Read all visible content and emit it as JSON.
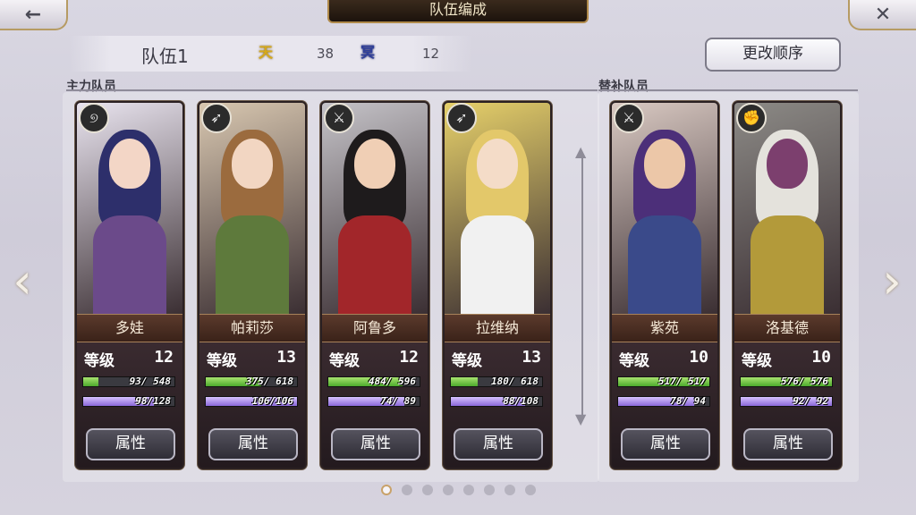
{
  "header": {
    "title": "队伍编成",
    "back_icon": "back-arrow-icon",
    "close_icon": "close-icon"
  },
  "team": {
    "name": "队伍1",
    "sun_stat": "38",
    "moon_stat": "12",
    "sun_glyph": "天",
    "moon_glyph": "冥"
  },
  "reorder_label": "更改顺序",
  "sections": {
    "main": "主力队员",
    "sub": "替补队员"
  },
  "members": [
    {
      "name": "多娃",
      "level_label": "等级",
      "level": "12",
      "hp": "93/ 548",
      "hp_frac": 0.17,
      "mp": "98/128",
      "mp_frac": 0.77,
      "attr_label": "属性",
      "weapon_icon": "staff-icon",
      "weapon_glyph": "୭",
      "hair": "#2d2f6b",
      "skin": "#f3d6c6",
      "body": "#6b4a8a",
      "bg": "#e9e4ef"
    },
    {
      "name": "帕莉莎",
      "level_label": "等级",
      "level": "13",
      "hp": "375/ 618",
      "hp_frac": 0.61,
      "mp": "106/106",
      "mp_frac": 1.0,
      "attr_label": "属性",
      "weapon_icon": "bow-icon",
      "weapon_glyph": "➶",
      "hair": "#9b6b3e",
      "skin": "#f2d6c2",
      "body": "#5e7a3c",
      "bg": "#d8c7b0"
    },
    {
      "name": "阿鲁多",
      "level_label": "等级",
      "level": "12",
      "hp": "484/ 596",
      "hp_frac": 0.81,
      "mp": "74/ 89",
      "mp_frac": 0.83,
      "attr_label": "属性",
      "weapon_icon": "sword-icon",
      "weapon_glyph": "⚔",
      "hair": "#1e1b1c",
      "skin": "#f0cfb5",
      "body": "#a2262a",
      "bg": "#c5c3c8"
    },
    {
      "name": "拉维纳",
      "level_label": "等级",
      "level": "13",
      "hp": "180/ 618",
      "hp_frac": 0.29,
      "mp": "88/108",
      "mp_frac": 0.81,
      "attr_label": "属性",
      "weapon_icon": "bow-icon",
      "weapon_glyph": "➶",
      "hair": "#e3c86a",
      "skin": "#f4dcc8",
      "body": "#f1f1f1",
      "bg": "#e6d06a"
    },
    {
      "name": "紫苑",
      "level_label": "等级",
      "level": "10",
      "hp": "517/ 517",
      "hp_frac": 1.0,
      "mp": "78/ 94",
      "mp_frac": 0.83,
      "attr_label": "属性",
      "weapon_icon": "blade-icon",
      "weapon_glyph": "⚔",
      "hair": "#4c2f79",
      "skin": "#ecc7a8",
      "body": "#3a4a8a",
      "bg": "#d9c9c2"
    },
    {
      "name": "洛基德",
      "level_label": "等级",
      "level": "10",
      "hp": "576/ 576",
      "hp_frac": 1.0,
      "mp": "92/ 92",
      "mp_frac": 1.0,
      "attr_label": "属性",
      "weapon_icon": "fist-icon",
      "weapon_glyph": "✊",
      "hair": "#e4e2dc",
      "skin": "#7c3f6e",
      "body": "#b39a3a",
      "bg": "#8c8a86"
    }
  ],
  "pager": {
    "pages": 8,
    "active": 0
  },
  "nav": {
    "left_glyph": "‹",
    "right_glyph": "›"
  }
}
